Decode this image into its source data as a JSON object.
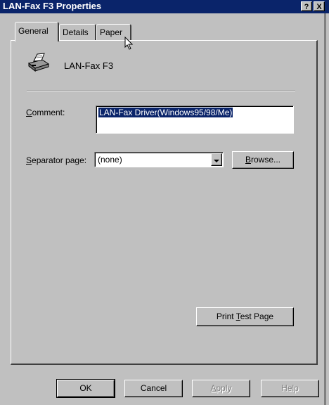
{
  "window": {
    "title": "LAN-Fax F3 Properties",
    "help_button": "?",
    "close_button": "X"
  },
  "tabs": [
    {
      "label": "General",
      "active": true
    },
    {
      "label": "Details",
      "active": false
    },
    {
      "label": "Paper",
      "active": false
    }
  ],
  "general": {
    "printer_name": "LAN-Fax F3",
    "comment_label_accel": "C",
    "comment_label_rest": "omment:",
    "comment_value": "LAN-Fax Driver(Windows95/98/Me)",
    "separator_label_accel": "S",
    "separator_label_rest": "eparator page:",
    "separator_value": "(none)",
    "browse_accel": "B",
    "browse_rest": "rowse...",
    "print_test_pre": "Print ",
    "print_test_accel": "T",
    "print_test_rest": "est Page"
  },
  "footer": {
    "ok": "OK",
    "cancel": "Cancel",
    "apply_accel": "A",
    "apply_rest": "pply",
    "help": "Help"
  },
  "colors": {
    "titlebar": "#0a246a",
    "face": "#c0c0c0",
    "selection": "#0a246a"
  }
}
